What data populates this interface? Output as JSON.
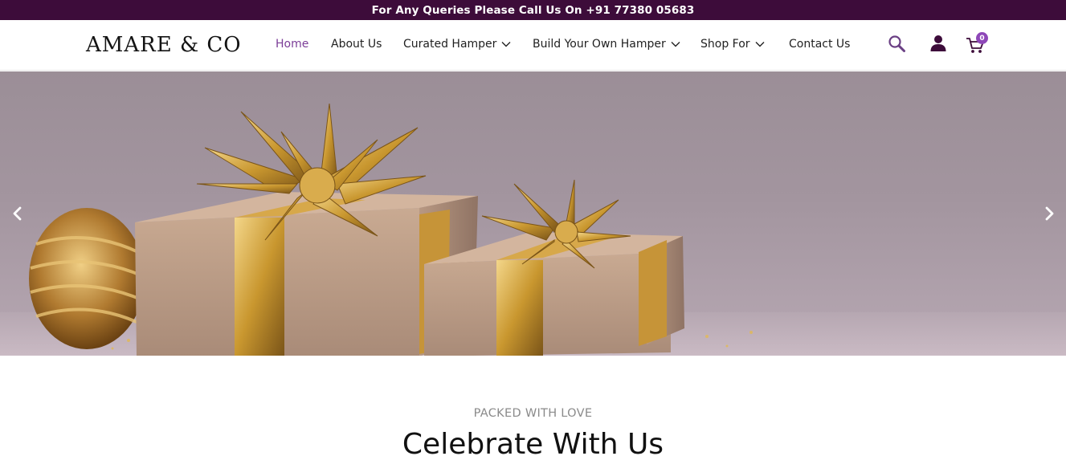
{
  "topbar": {
    "text": "For Any Queries Please Call Us On +91 77380 05683"
  },
  "brand": {
    "logo_text": "AMARE & CO"
  },
  "nav": {
    "items": [
      {
        "label": "Home",
        "active": true,
        "dropdown": false
      },
      {
        "label": "About Us",
        "active": false,
        "dropdown": false
      },
      {
        "label": "Curated Hamper",
        "active": false,
        "dropdown": true
      },
      {
        "label": "Build Your Own Hamper",
        "active": false,
        "dropdown": true
      },
      {
        "label": "Shop For",
        "active": false,
        "dropdown": true
      },
      {
        "label": "Contact Us",
        "active": false,
        "dropdown": false
      }
    ]
  },
  "header_icons": {
    "search": "search-icon",
    "account": "user-icon",
    "cart": "cart-icon",
    "cart_count": "0"
  },
  "hero": {
    "prev": "chevron-left-icon",
    "next": "chevron-right-icon"
  },
  "intro": {
    "tagline": "PACKED WITH LOVE",
    "heading": "Celebrate With Us"
  },
  "colors": {
    "topbar_bg": "#3d0c3a",
    "accent": "#7b3d97",
    "badge": "#8e47b8",
    "icon_dark": "#3d0c3a"
  }
}
